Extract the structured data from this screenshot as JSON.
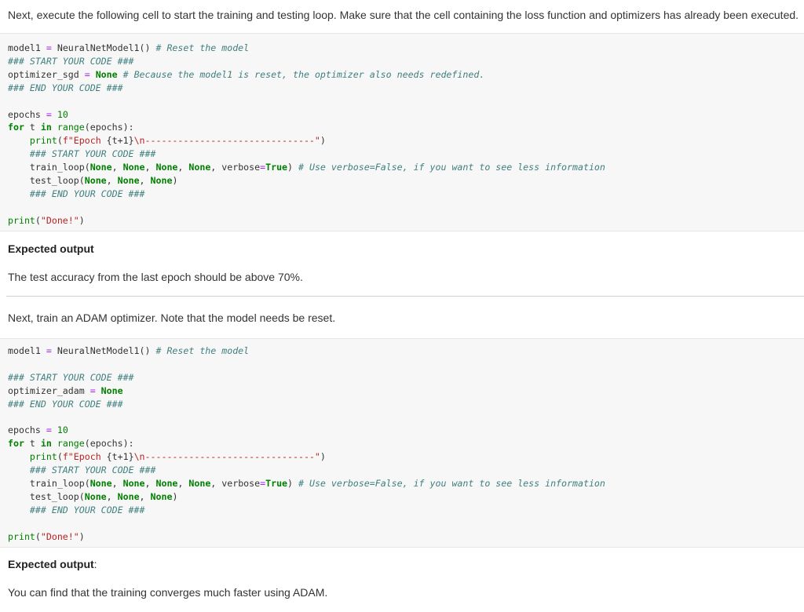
{
  "intro_text": "Next, execute the following cell to start the training and testing loop. Make sure that the cell containing the loss function and optimizers has already been executed.",
  "cell1": {
    "lines": [
      [
        [
          "model1 ",
          ""
        ],
        [
          "=",
          "op"
        ],
        [
          " NeuralNetModel1() ",
          ""
        ],
        [
          "# Reset the model",
          "cm"
        ]
      ],
      [
        [
          "### START YOUR CODE ###",
          "cm"
        ]
      ],
      [
        [
          "optimizer_sgd ",
          ""
        ],
        [
          "=",
          "op"
        ],
        [
          " ",
          ""
        ],
        [
          "None",
          "kw"
        ],
        [
          " ",
          ""
        ],
        [
          "# Because the model1 is reset, the optimizer also needs redefined.",
          "cm"
        ]
      ],
      [
        [
          "### END YOUR CODE ###",
          "cm"
        ]
      ],
      [],
      [
        [
          "epochs ",
          ""
        ],
        [
          "=",
          "op"
        ],
        [
          " ",
          ""
        ],
        [
          "10",
          "num"
        ]
      ],
      [
        [
          "for",
          "kw"
        ],
        [
          " t ",
          ""
        ],
        [
          "in",
          "kw"
        ],
        [
          " ",
          ""
        ],
        [
          "range",
          "bi"
        ],
        [
          "(epochs):",
          ""
        ]
      ],
      [
        [
          "    ",
          ""
        ],
        [
          "print",
          "bi"
        ],
        [
          "(",
          ""
        ],
        [
          "f\"Epoch ",
          "str"
        ],
        [
          "{t+1}",
          ""
        ],
        [
          "\\n-------------------------------\"",
          "str"
        ],
        [
          ")",
          ""
        ]
      ],
      [
        [
          "    ",
          ""
        ],
        [
          "### START YOUR CODE ###",
          "cm"
        ]
      ],
      [
        [
          "    train_loop(",
          ""
        ],
        [
          "None",
          "kw"
        ],
        [
          ", ",
          ""
        ],
        [
          "None",
          "kw"
        ],
        [
          ", ",
          ""
        ],
        [
          "None",
          "kw"
        ],
        [
          ", ",
          ""
        ],
        [
          "None",
          "kw"
        ],
        [
          ", verbose",
          ""
        ],
        [
          "=",
          "op"
        ],
        [
          "True",
          "kw"
        ],
        [
          ") ",
          ""
        ],
        [
          "# Use verbose=False, if you want to see less information",
          "cm"
        ]
      ],
      [
        [
          "    test_loop(",
          ""
        ],
        [
          "None",
          "kw"
        ],
        [
          ", ",
          ""
        ],
        [
          "None",
          "kw"
        ],
        [
          ", ",
          ""
        ],
        [
          "None",
          "kw"
        ],
        [
          ")",
          ""
        ]
      ],
      [
        [
          "    ",
          ""
        ],
        [
          "### END YOUR CODE ###",
          "cm"
        ]
      ],
      [],
      [
        [
          "print",
          "bi"
        ],
        [
          "(",
          ""
        ],
        [
          "\"Done!\"",
          "str"
        ],
        [
          ")",
          ""
        ]
      ]
    ]
  },
  "expected_output_1": "Expected output",
  "expected_text_1": "The test accuracy from the last epoch should be above 70%.",
  "adam_text": "Next, train an ADAM optimizer. Note that the model needs be reset.",
  "cell2": {
    "lines": [
      [
        [
          "model1 ",
          ""
        ],
        [
          "=",
          "op"
        ],
        [
          " NeuralNetModel1() ",
          ""
        ],
        [
          "# Reset the model",
          "cm"
        ]
      ],
      [],
      [
        [
          "### START YOUR CODE ###",
          "cm"
        ]
      ],
      [
        [
          "optimizer_adam ",
          ""
        ],
        [
          "=",
          "op"
        ],
        [
          " ",
          ""
        ],
        [
          "None",
          "kw"
        ]
      ],
      [
        [
          "### END YOUR CODE ###",
          "cm"
        ]
      ],
      [],
      [
        [
          "epochs ",
          ""
        ],
        [
          "=",
          "op"
        ],
        [
          " ",
          ""
        ],
        [
          "10",
          "num"
        ]
      ],
      [
        [
          "for",
          "kw"
        ],
        [
          " t ",
          ""
        ],
        [
          "in",
          "kw"
        ],
        [
          " ",
          ""
        ],
        [
          "range",
          "bi"
        ],
        [
          "(epochs):",
          ""
        ]
      ],
      [
        [
          "    ",
          ""
        ],
        [
          "print",
          "bi"
        ],
        [
          "(",
          ""
        ],
        [
          "f\"Epoch ",
          "str"
        ],
        [
          "{t+1}",
          ""
        ],
        [
          "\\n-------------------------------\"",
          "str"
        ],
        [
          ")",
          ""
        ]
      ],
      [
        [
          "    ",
          ""
        ],
        [
          "### START YOUR CODE ###",
          "cm"
        ]
      ],
      [
        [
          "    train_loop(",
          ""
        ],
        [
          "None",
          "kw"
        ],
        [
          ", ",
          ""
        ],
        [
          "None",
          "kw"
        ],
        [
          ", ",
          ""
        ],
        [
          "None",
          "kw"
        ],
        [
          ", ",
          ""
        ],
        [
          "None",
          "kw"
        ],
        [
          ", verbose",
          ""
        ],
        [
          "=",
          "op"
        ],
        [
          "True",
          "kw"
        ],
        [
          ") ",
          ""
        ],
        [
          "# Use verbose=False, if you want to see less information",
          "cm"
        ]
      ],
      [
        [
          "    test_loop(",
          ""
        ],
        [
          "None",
          "kw"
        ],
        [
          ", ",
          ""
        ],
        [
          "None",
          "kw"
        ],
        [
          ", ",
          ""
        ],
        [
          "None",
          "kw"
        ],
        [
          ")",
          ""
        ]
      ],
      [
        [
          "    ",
          ""
        ],
        [
          "### END YOUR CODE ###",
          "cm"
        ]
      ],
      [],
      [
        [
          "print",
          "bi"
        ],
        [
          "(",
          ""
        ],
        [
          "\"Done!\"",
          "str"
        ],
        [
          ")",
          ""
        ]
      ]
    ]
  },
  "expected_output_2": "Expected output",
  "expected_output_2_colon": ":",
  "expected_text_2": "You can find that the training converges much faster using ADAM."
}
